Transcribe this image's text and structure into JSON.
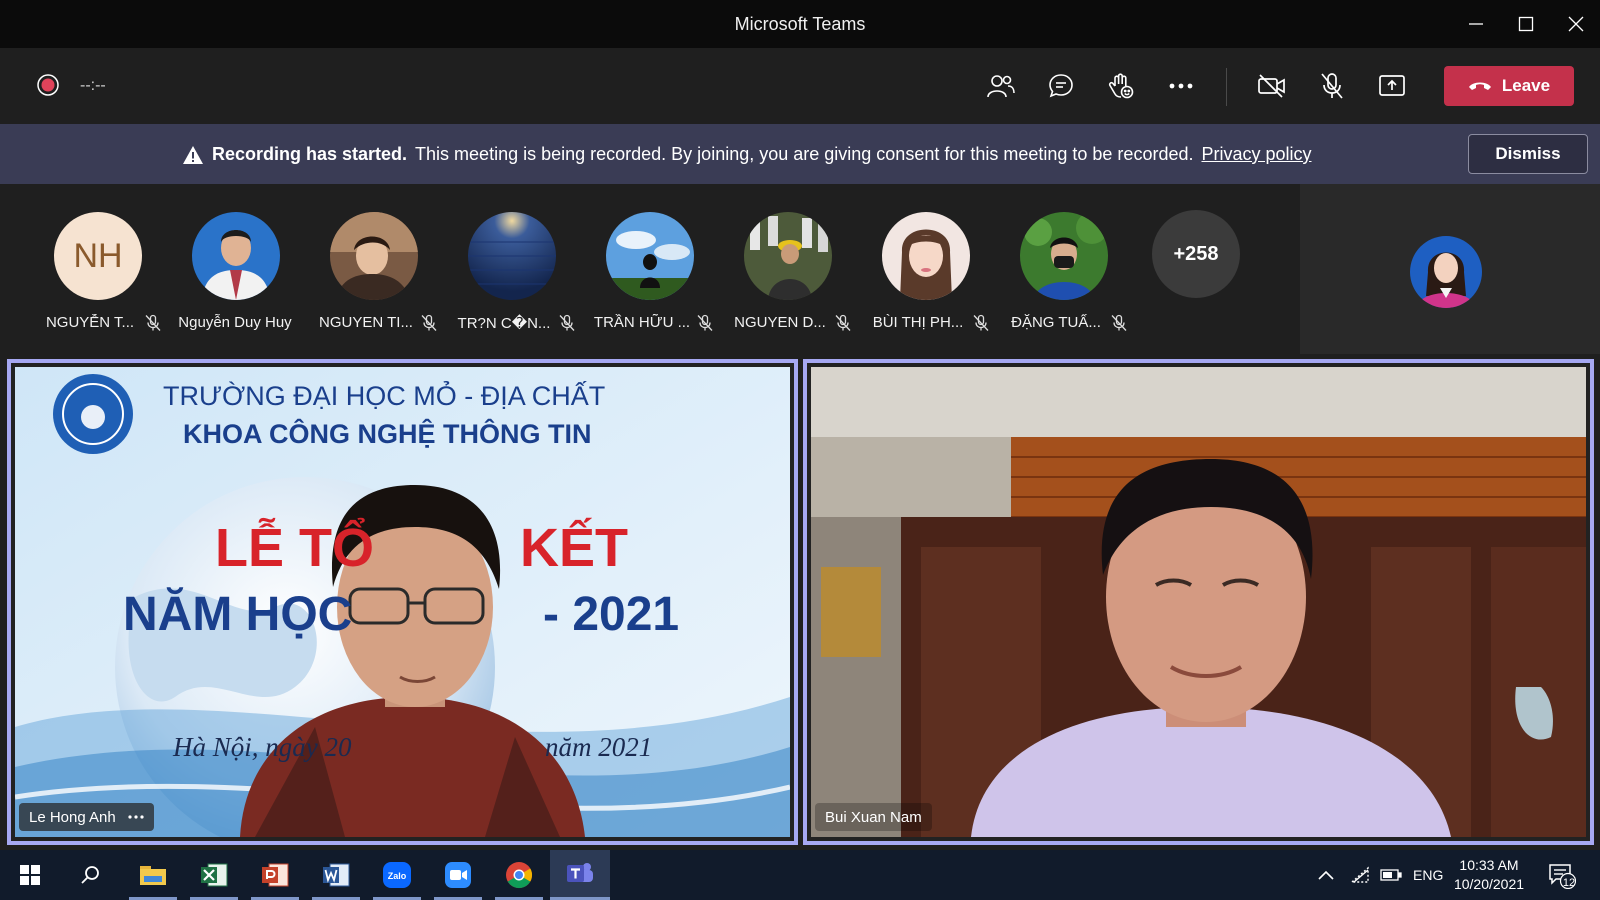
{
  "window": {
    "title": "Microsoft Teams"
  },
  "toolbar": {
    "timer": "--:--",
    "leave_label": "Leave"
  },
  "banner": {
    "bold": "Recording has started.",
    "text": "This meeting is being recorded. By joining, you are giving consent for this meeting to be recorded.",
    "link": "Privacy policy",
    "dismiss_label": "Dismiss"
  },
  "participants": [
    {
      "name": "NGUYỄN T...",
      "initials": "NH",
      "muted": true
    },
    {
      "name": "Nguyễn Duy Huy",
      "muted": false
    },
    {
      "name": "NGUYEN TI...",
      "muted": true
    },
    {
      "name": "TR?N C�N...",
      "muted": true
    },
    {
      "name": "TRẦN HỮU ...",
      "muted": true
    },
    {
      "name": "NGUYEN D...",
      "muted": true
    },
    {
      "name": "BÙI THỊ PH...",
      "muted": true
    },
    {
      "name": "ĐẶNG TUẤ...",
      "muted": true
    }
  ],
  "more_participants": "+258",
  "tiles": [
    {
      "name": "Le Hong Anh",
      "slide": {
        "line1": "TRƯỜNG ĐẠI HỌC MỎ - ĐỊA CHẤT",
        "line2": "KHOA CÔNG NGHỆ THÔNG TIN",
        "title_a": "LỄ TỔ",
        "title_b": "KẾT",
        "year_a": "NĂM HỌC",
        "year_b": "- 2021",
        "date_a": "Hà Nội, ngày 20",
        "date_b": "năm 2021"
      }
    },
    {
      "name": "Bui Xuan Nam"
    }
  ],
  "taskbar": {
    "language": "ENG",
    "time": "10:33 AM",
    "date": "10/20/2021",
    "notifications": "12"
  },
  "colors": {
    "accent": "#a6a8f2",
    "leave": "#c4314b",
    "banner": "#3a3c55",
    "record": "#e0435a"
  }
}
